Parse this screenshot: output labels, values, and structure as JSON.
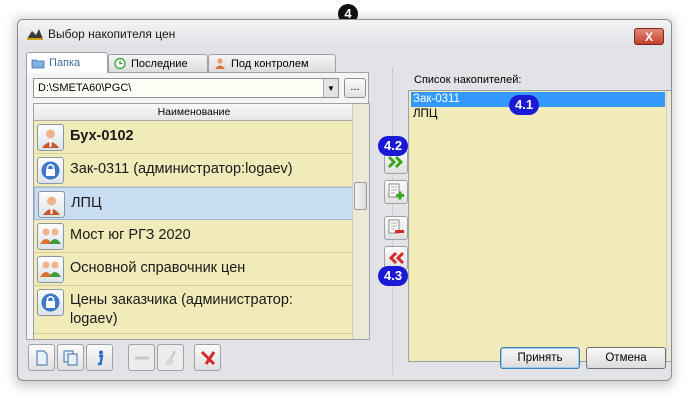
{
  "window": {
    "title": "Выбор накопителя цен",
    "close_label": "X"
  },
  "tabs": [
    {
      "label": "Папка",
      "icon": "folder-icon",
      "active": true
    },
    {
      "label": "Последние",
      "icon": "recent-icon",
      "active": false
    },
    {
      "label": "Под контролем",
      "icon": "user-control-icon",
      "active": false
    }
  ],
  "path": {
    "value": "D:\\SMETA60\\PGC\\",
    "browse_label": "..."
  },
  "list": {
    "column_header": "Наименование",
    "items": [
      {
        "label": "Бух-0102",
        "icon": "user-icon",
        "bold": true
      },
      {
        "label": "Зак-0311 (администратор:logaev)",
        "icon": "lock-icon",
        "bold": false
      },
      {
        "label": "ЛПЦ",
        "icon": "user-icon",
        "bold": false,
        "selected": true
      },
      {
        "label": "Мост юг РГЗ 2020",
        "icon": "group-icon",
        "bold": false
      },
      {
        "label": "Основной справочник цен",
        "icon": "group-icon",
        "bold": false
      },
      {
        "label": "Цены заказчика (администратор:",
        "label2": "logaev)",
        "icon": "lock-icon",
        "bold": false
      }
    ]
  },
  "right": {
    "label": "Список накопителей:",
    "items": [
      {
        "label": "Зак-0311",
        "selected": true
      },
      {
        "label": "ЛПЦ",
        "selected": false
      }
    ]
  },
  "buttons": {
    "accept": "Принять",
    "cancel": "Отмена"
  },
  "callouts": {
    "main": "4",
    "c41": "4.1",
    "c42": "4.2",
    "c43": "4.3"
  },
  "colors": {
    "list_bg": "#f1ebb9",
    "selection": "#3399ff",
    "callout": "#1a1ad6",
    "add_arrow": "#3aa81c",
    "remove_arrow": "#d42a2a"
  }
}
